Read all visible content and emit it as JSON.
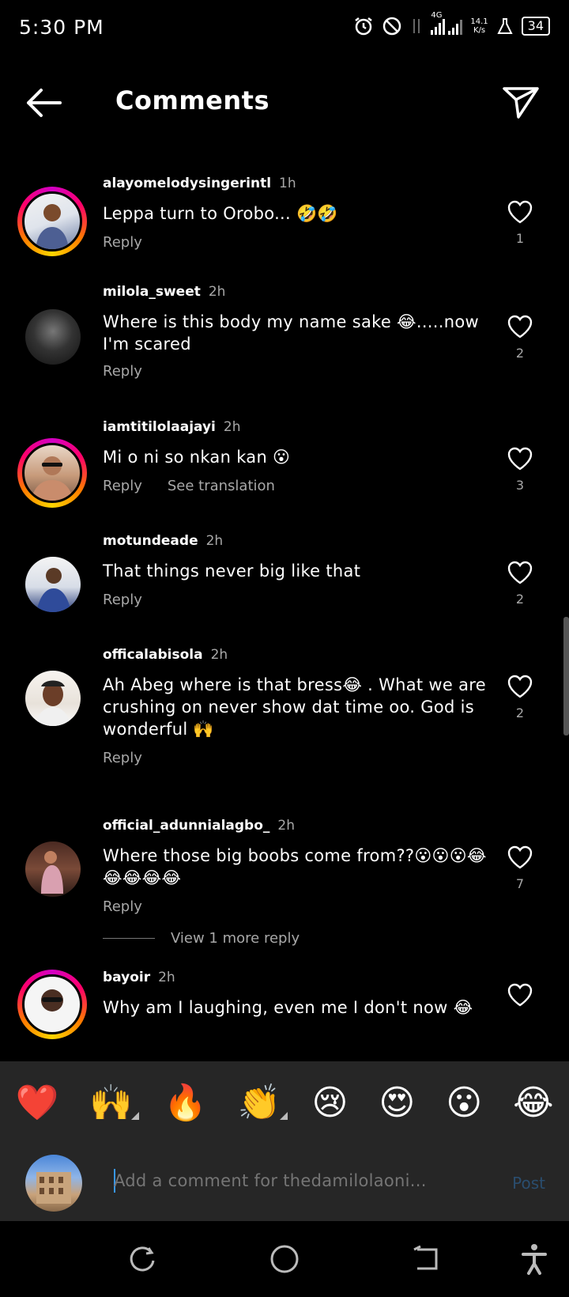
{
  "status_bar": {
    "time": "5:30 PM",
    "network_type": "4G",
    "speed_value": "14.1",
    "speed_unit": "K/s",
    "battery": "34"
  },
  "header": {
    "title": "Comments"
  },
  "comments": [
    {
      "username": "alayomelodysingerintl",
      "time": "1h",
      "text": "Leppa turn to Orobo... 🤣🤣",
      "reply_label": "Reply",
      "likes": "1"
    },
    {
      "username": "milola_sweet",
      "time": "2h",
      "text": "Where is this body my name sake 😂.....now I'm scared",
      "reply_label": "Reply",
      "likes": "2"
    },
    {
      "username": "iamtitilolaajayi",
      "time": "2h",
      "text": "Mi o ni so nkan kan 😮",
      "reply_label": "Reply",
      "translate_label": "See translation",
      "likes": "3"
    },
    {
      "username": "motundeade",
      "time": "2h",
      "text": "That things never big like that",
      "reply_label": "Reply",
      "likes": "2"
    },
    {
      "username": "officalabisola",
      "time": "2h",
      "text": "Ah Abeg where is that bress😂 .  What we are crushing on never show dat time oo. God is wonderful 🙌",
      "reply_label": "Reply",
      "likes": "2"
    },
    {
      "username": "official_adunnialagbo_",
      "time": "2h",
      "text": "Where those big boobs come from??😮😮😮😂😂😂😂😂",
      "reply_label": "Reply",
      "likes": "7"
    },
    {
      "username": "bayoir",
      "time": "2h",
      "text": "Why am I laughing, even me I don't now 😂"
    }
  ],
  "view_more_replies": "View 1 more reply",
  "quick_reactions": [
    "❤️",
    "🙌",
    "🔥",
    "👏",
    "😢",
    "😍",
    "😮",
    "😂"
  ],
  "composer": {
    "placeholder": "Add a comment for thedamilolaoni...",
    "post_label": "Post"
  },
  "icons": {
    "back": "arrow-left-icon",
    "share": "paper-plane-icon",
    "like": "heart-outline-icon",
    "nav": [
      "recent-apps-icon",
      "home-icon",
      "back-nav-icon",
      "accessibility-icon"
    ]
  }
}
